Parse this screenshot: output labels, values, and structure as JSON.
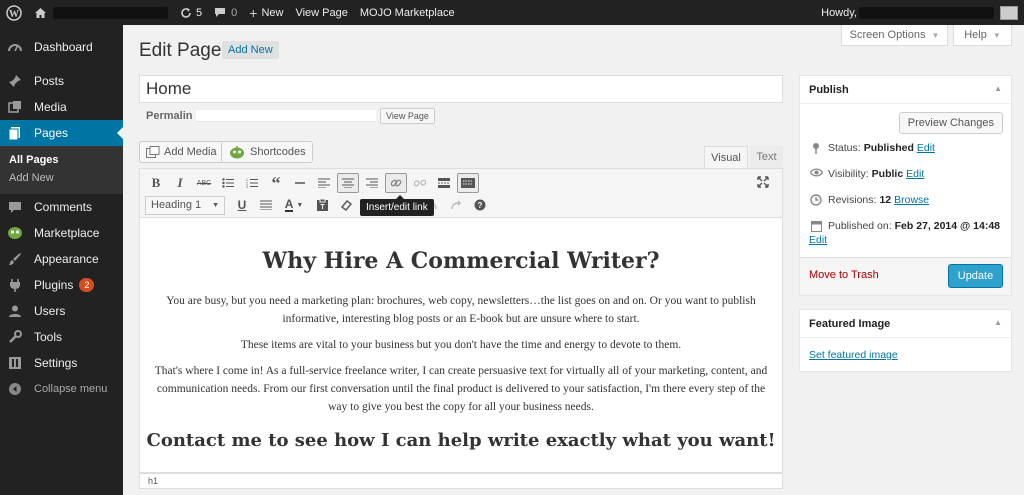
{
  "adminbar": {
    "updates_count": "5",
    "comments_count": "0",
    "new_label": "New",
    "view_page_label": "View Page",
    "marketplace_label": "MOJO Marketplace",
    "howdy_label": "Howdy,"
  },
  "sidebar": {
    "items": [
      {
        "label": "Dashboard",
        "icon": "dashboard-icon"
      },
      {
        "label": "Posts",
        "icon": "pin-icon"
      },
      {
        "label": "Media",
        "icon": "media-icon"
      },
      {
        "label": "Pages",
        "icon": "pages-icon"
      },
      {
        "label": "Comments",
        "icon": "comment-icon"
      },
      {
        "label": "Marketplace",
        "icon": "marketplace-icon"
      },
      {
        "label": "Appearance",
        "icon": "brush-icon"
      },
      {
        "label": "Plugins",
        "icon": "plugin-icon",
        "badge": "2"
      },
      {
        "label": "Users",
        "icon": "user-icon"
      },
      {
        "label": "Tools",
        "icon": "wrench-icon"
      },
      {
        "label": "Settings",
        "icon": "settings-icon"
      }
    ],
    "submenu": [
      "All Pages",
      "Add New"
    ],
    "collapse_label": "Collapse menu"
  },
  "header": {
    "title": "Edit Page",
    "add_new_label": "Add New",
    "screen_options_label": "Screen Options",
    "help_label": "Help"
  },
  "editor": {
    "post_title": "Home",
    "permalink_label": "Permalin",
    "view_page_button": "View Page",
    "add_media_label": "Add Media",
    "shortcodes_label": "Shortcodes",
    "tab_visual": "Visual",
    "tab_text": "Text",
    "format_value": "Heading 1",
    "tooltip": "Insert/edit link",
    "heading": "Why Hire A Commercial Writer?",
    "para1": "You are busy, but you need a marketing plan: brochures, web copy, newsletters…the list goes on and on. Or you want to publish informative, interesting blog posts or an E-book but are unsure where to start.",
    "para2": "These items are vital to your business but you don't have the time and energy to devote to them.",
    "para3": "That's where I come in! As a full-service freelance writer, I can create persuasive text for virtually all of your marketing, content, and communication needs. From our first conversation until the final product is delivered to your satisfaction, I'm there every step of the way to give you best the copy for all your business needs.",
    "subheading": "Contact me to see how I can help write exactly what you want!",
    "status_path": "h1"
  },
  "publish": {
    "title": "Publish",
    "preview_label": "Preview Changes",
    "status_label": "Status:",
    "status_value": "Published",
    "visibility_label": "Visibility:",
    "visibility_value": "Public",
    "revisions_label": "Revisions:",
    "revisions_value": "12",
    "browse_label": "Browse",
    "published_label": "Published on:",
    "published_value": "Feb 27, 2014 @ 14:48",
    "edit_label": "Edit",
    "trash_label": "Move to Trash",
    "update_label": "Update"
  },
  "featured": {
    "title": "Featured Image",
    "link": "Set featured image"
  },
  "colors": {
    "accent": "#0074a2",
    "update_button": "#2ea2cc",
    "sidebar_bg": "#222222",
    "trash": "#aa0000",
    "badge": "#d54e21"
  }
}
